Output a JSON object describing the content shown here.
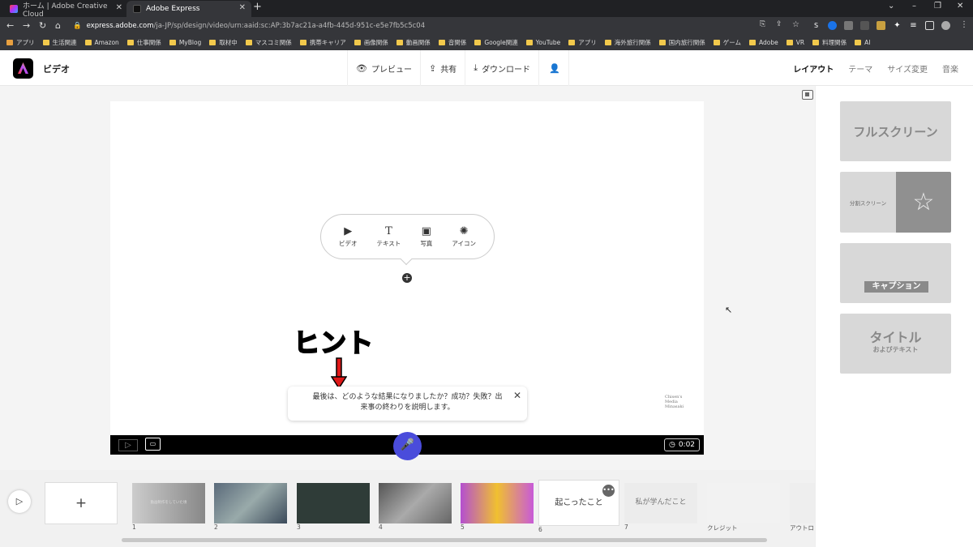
{
  "browser": {
    "tabs": [
      {
        "title": "ホーム | Adobe Creative Cloud"
      },
      {
        "title": "Adobe Express"
      }
    ],
    "url_host": "express.adobe.com",
    "url_path": "/ja-JP/sp/design/video/urn:aaid:sc:AP:3b7ac21a-a4fb-445d-951c-e5e7fb5c5c04",
    "bookmarks": [
      "アプリ",
      "生活関連",
      "Amazon",
      "仕事関係",
      "MyBlog",
      "取材中",
      "マスコミ関係",
      "携帯キャリア",
      "画像関係",
      "動画関係",
      "音関係",
      "Google関連",
      "YouTube",
      "アプリ",
      "海外旅行関係",
      "国内旅行関係",
      "ゲーム",
      "Adobe",
      "VR",
      "料理関係",
      "AI"
    ]
  },
  "header": {
    "title": "ビデオ",
    "preview": "プレビュー",
    "share": "共有",
    "download": "ダウンロード"
  },
  "right_nav": [
    "レイアウト",
    "テーマ",
    "サイズ変更",
    "音楽"
  ],
  "add_menu": [
    "ビデオ",
    "テキスト",
    "写真",
    "アイコン"
  ],
  "hint_text": "ヒント",
  "prompt_bubble": "最後は、どのような結果になりましたか？成功？失敗？出来事の終わりを説明します。",
  "watermark": "Chisen's Media Minasaki",
  "timer": "0:02",
  "layouts": {
    "fullscreen": "フルスクリーン",
    "split": "分割スクリーン",
    "caption": "キャプション",
    "title_main": "タイトル",
    "title_sub": "およびテキスト"
  },
  "timeline": {
    "scene_numbers": [
      "1",
      "2",
      "3",
      "4",
      "5",
      "6",
      "7",
      "クレジット",
      "アウトロ"
    ],
    "scene_6_label": "起こったこと",
    "scene_7_label": "私が学んだこと",
    "scene_1_caption": "動画制作をしていた頃"
  },
  "colors": {
    "accent": "#4a4cdb",
    "hint": "#e01818"
  }
}
